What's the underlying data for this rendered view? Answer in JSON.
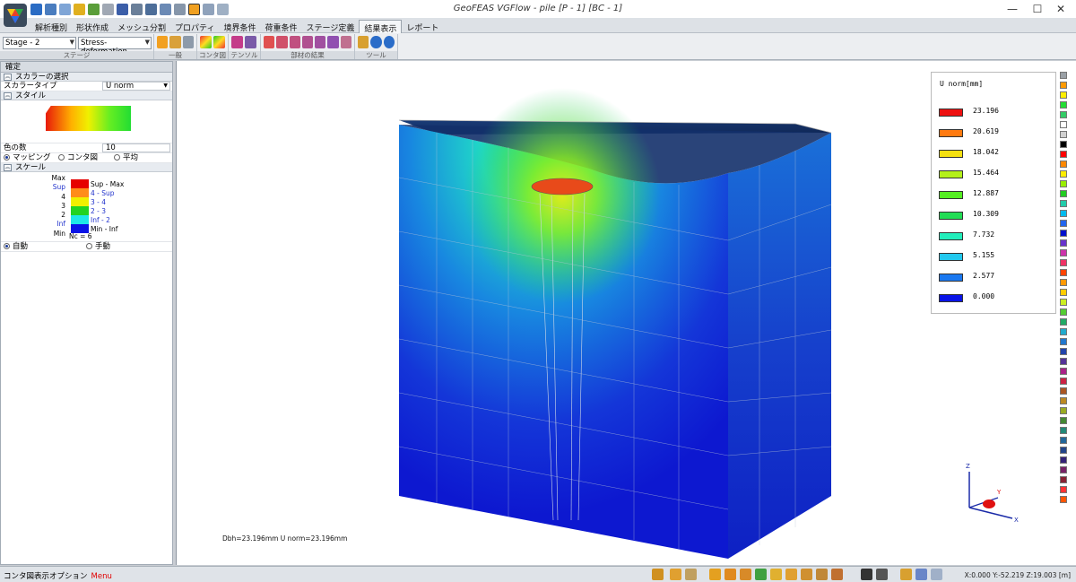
{
  "window": {
    "title": "GeoFEAS VGFlow - pile [P - 1] [BC - 1]",
    "controls": {
      "minimize": "—",
      "maximize": "☐",
      "close": "✕"
    }
  },
  "menu": {
    "tabs": [
      "解析種別",
      "形状作成",
      "メッシュ分割",
      "プロパティ",
      "境界条件",
      "荷重条件",
      "ステージ定義",
      "結果表示",
      "レポート"
    ],
    "active_tab": "結果表示"
  },
  "ribbon": {
    "stage_select": "Stage - 2",
    "result_select": "Stress-deformation",
    "group_labels": [
      "ステージ",
      "一般",
      "コンタ図",
      "テンソル",
      "部材の結果",
      "ツール"
    ]
  },
  "panel": {
    "confirm_label": "確定",
    "scalar_section": "スカラーの選択",
    "scalar_type_label": "スカラータイプ",
    "scalar_type_value": "U norm",
    "style_section": "スタイル",
    "num_colors_label": "色の数",
    "num_colors_value": "10",
    "mode_options": [
      "マッピング",
      "コンタ図",
      "平均"
    ],
    "scale_section": "スケール",
    "scale_left": [
      "Max",
      "Sup",
      "4",
      "3",
      "2",
      "Inf",
      "Min"
    ],
    "scale_items": [
      {
        "label": "Sup - Max",
        "color": "#e60000"
      },
      {
        "label": "4 - Sup",
        "color": "#ff8c1a"
      },
      {
        "label": "3 - 4",
        "color": "#f0f000"
      },
      {
        "label": "2 - 3",
        "color": "#22d322"
      },
      {
        "label": "Inf - 2",
        "color": "#1ee8e8"
      },
      {
        "label": "Min - Inf",
        "color": "#0a14e6"
      }
    ],
    "nc_label": "Nc = 6",
    "auto_label": "自動",
    "manual_label": "手動"
  },
  "legend": {
    "title": "U norm[mm]",
    "entries": [
      {
        "value": "23.196",
        "color": "#ee1111"
      },
      {
        "value": "20.619",
        "color": "#ff7a10"
      },
      {
        "value": "18.042",
        "color": "#f5e010"
      },
      {
        "value": "15.464",
        "color": "#b4f01a"
      },
      {
        "value": "12.887",
        "color": "#55ee22"
      },
      {
        "value": "10.309",
        "color": "#22dd55"
      },
      {
        "value": "7.732",
        "color": "#22eebb"
      },
      {
        "value": "5.155",
        "color": "#22c8ee"
      },
      {
        "value": "2.577",
        "color": "#1a78f0"
      },
      {
        "value": "0.000",
        "color": "#0a14e6"
      }
    ]
  },
  "palette_colors": [
    "#9aa0a6",
    "#ff9a00",
    "#ffee00",
    "#22dd33",
    "#33cc66",
    "#ffffff",
    "#d0d0d0",
    "#000000",
    "#ff0000",
    "#ff8800",
    "#ffee00",
    "#99ee00",
    "#22cc22",
    "#22ccaa",
    "#00bbee",
    "#2266ee",
    "#0011cc",
    "#6633cc",
    "#cc33aa",
    "#ee3366",
    "#ff4400",
    "#ff9900",
    "#ffcc00",
    "#ccee22",
    "#55cc33",
    "#22aa66",
    "#22aacc",
    "#2277cc",
    "#2244aa",
    "#553399",
    "#aa2288",
    "#cc2244",
    "#aa5522",
    "#bb8822",
    "#99aa22",
    "#448833",
    "#228877",
    "#226699",
    "#224488",
    "#332277",
    "#772266",
    "#882233",
    "#ff3333",
    "#ff5500"
  ],
  "viewport": {
    "readout": "Dbh=23.196mm  U norm=23.196mm",
    "axes": {
      "x": "X",
      "y": "Y",
      "z": "Z"
    }
  },
  "status": {
    "left_label": "コンタ図表示オプション",
    "menu_label": "Menu",
    "coords": "X:0.000 Y:-52.219 Z:19.003 [m]"
  }
}
